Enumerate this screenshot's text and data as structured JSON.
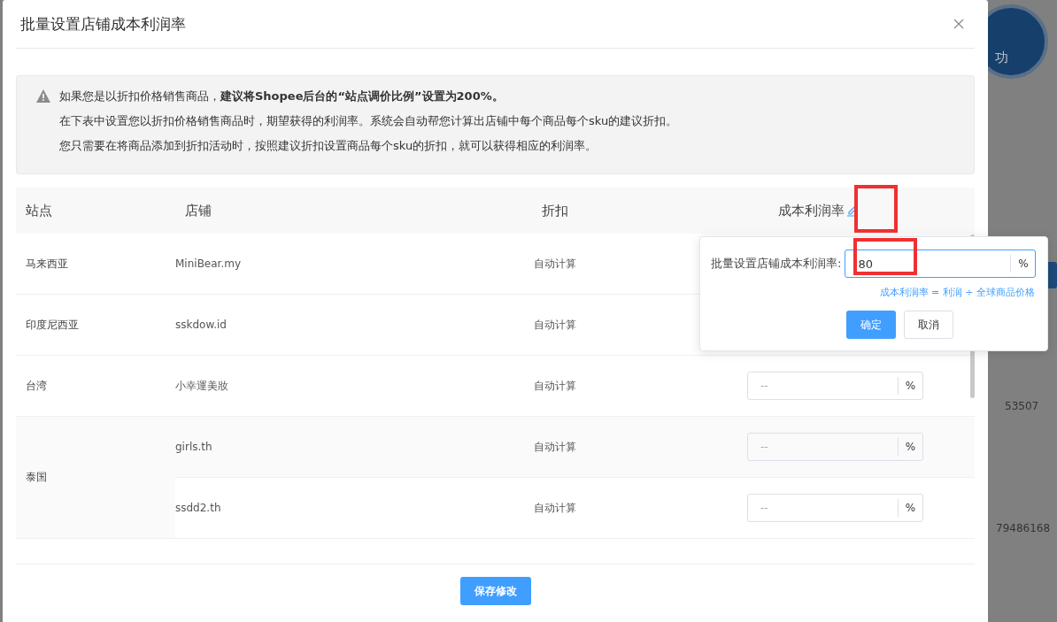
{
  "background": {
    "badge_text": "功",
    "values": [
      "53507",
      "79486168"
    ]
  },
  "dialog": {
    "title": "批量设置店铺成本利润率",
    "notice": [
      "如果您是以折扣价格销售商品，**建议将Shopee后台的“站点调价比例”设置为200%。**",
      "在下表中设置您以折扣价格销售商品时，期望获得的利润率。系统会自动帮您计算出店铺中每个商品每个sku的建议折扣。",
      "您只需要在将商品添加到折扣活动时，按照建议折扣设置商品每个sku的折扣，就可以获得相应的利润率。"
    ],
    "table": {
      "columns": [
        "站点",
        "店铺",
        "折扣",
        "成本利润率"
      ],
      "sites": [
        {
          "name": "马来西亚",
          "shops": [
            {
              "name": "MiniBear.my",
              "discount": "自动计算"
            }
          ]
        },
        {
          "name": "印度尼西亚",
          "shops": [
            {
              "name": "sskdow.id",
              "discount": "自动计算"
            }
          ]
        },
        {
          "name": "台湾",
          "shops": [
            {
              "name": "小幸運美妝",
              "discount": "自动计算",
              "placeholder": "--",
              "unit": "%"
            }
          ]
        },
        {
          "name": "泰国",
          "shops": [
            {
              "name": "girls.th",
              "discount": "自动计算",
              "placeholder": "--",
              "unit": "%"
            },
            {
              "name": "ssdd2.th",
              "discount": "自动计算",
              "placeholder": "--",
              "unit": "%"
            }
          ]
        }
      ]
    },
    "popover": {
      "label": "批量设置店铺成本利润率:",
      "value": "80",
      "unit": "%",
      "hint": "成本利润率 = 利润 ÷ 全球商品价格",
      "confirm": "确定",
      "cancel": "取消"
    },
    "save_button": "保存修改"
  }
}
